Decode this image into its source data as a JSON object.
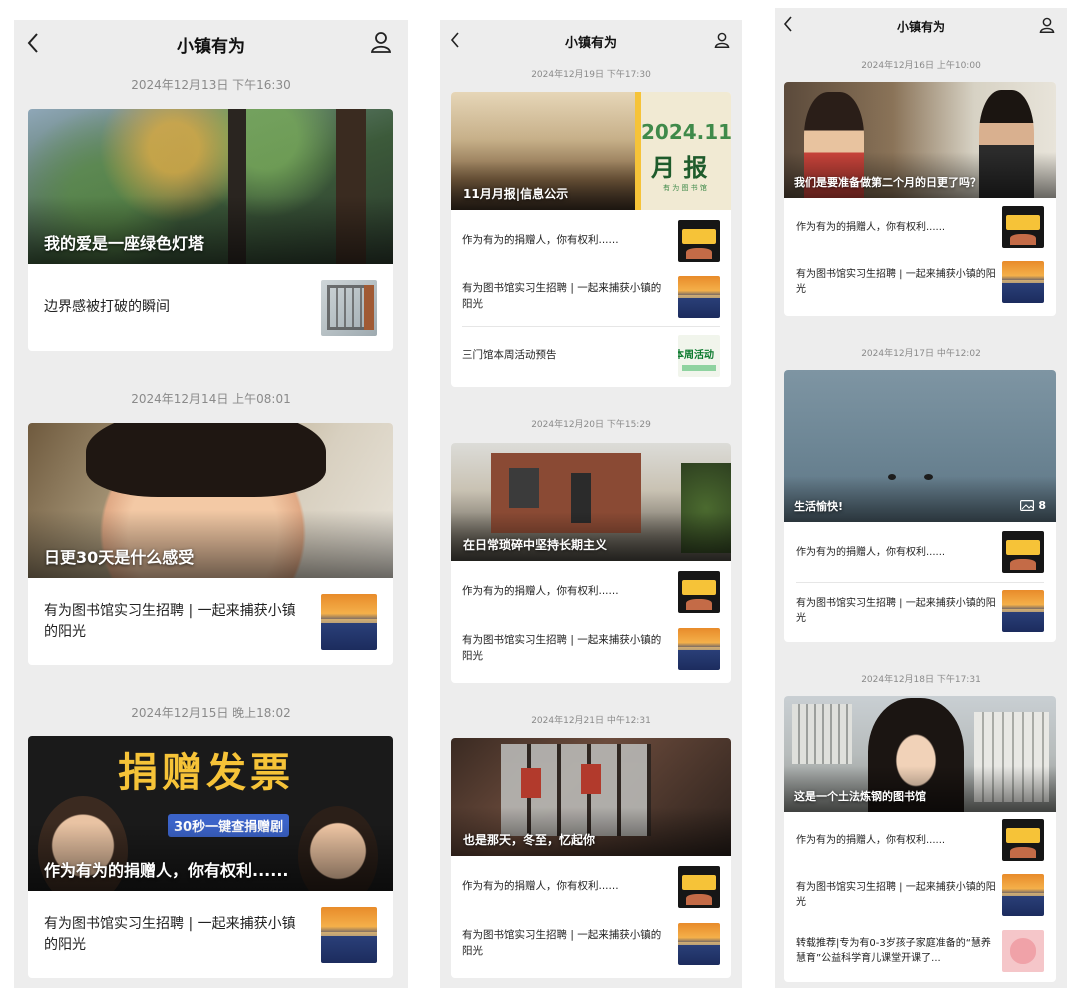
{
  "app_title": "小镇有为",
  "screens": [
    {
      "posts": [
        {
          "timestamp": "2024年12月13日 下午16:30",
          "hero_title": "我的爱是一座绿色灯塔",
          "items": [
            {
              "title": "边界感被打破的瞬间",
              "thumb": "window-thumbnail"
            }
          ]
        },
        {
          "timestamp": "2024年12月14日 上午08:01",
          "hero_title": "日更30天是什么感受",
          "items": [
            {
              "title": "有为图书馆实习生招聘 | 一起来捕获小镇的阳光",
              "thumb": "sunset-thumbnail"
            }
          ]
        },
        {
          "timestamp": "2024年12月15日 晚上18:02",
          "hero_title": "作为有为的捐赠人，你有权利......",
          "hero_overlay_big": "捐赠发票",
          "hero_overlay_small": "30秒一键查捐赠剧",
          "items": [
            {
              "title": "有为图书馆实习生招聘 | 一起来捕获小镇的阳光",
              "thumb": "sunset-thumbnail"
            }
          ]
        }
      ]
    },
    {
      "posts": [
        {
          "timestamp": "2024年12月19日 下午17:30",
          "hero_title": "11月月报|信息公示",
          "hero_overlay_year": "2024.11",
          "hero_overlay_big": "月 报",
          "hero_overlay_small": "有 为 图 书 馆",
          "items": [
            {
              "title": "作为有为的捐赠人，你有权利......",
              "thumb": "donate-thumbnail"
            },
            {
              "title": "有为图书馆实习生招聘 | 一起来捕获小镇的阳光",
              "thumb": "sunset-thumbnail"
            },
            {
              "title": "三门馆本周活动预告",
              "thumb": "weekly-thumbnail",
              "thumb_text": "本周活动"
            }
          ]
        },
        {
          "timestamp": "2024年12月20日 下午15:29",
          "hero_title": "在日常琐碎中坚持长期主义",
          "items": [
            {
              "title": "作为有为的捐赠人，你有权利......",
              "thumb": "donate-thumbnail"
            },
            {
              "title": "有为图书馆实习生招聘 | 一起来捕获小镇的阳光",
              "thumb": "sunset-thumbnail"
            }
          ]
        },
        {
          "timestamp": "2024年12月21日 中午12:31",
          "hero_title": "也是那天，冬至，忆起你",
          "items": [
            {
              "title": "作为有为的捐赠人，你有权利......",
              "thumb": "donate-thumbnail"
            },
            {
              "title": "有为图书馆实习生招聘 | 一起来捕获小镇的阳光",
              "thumb": "sunset-thumbnail"
            }
          ]
        }
      ]
    },
    {
      "posts": [
        {
          "timestamp": "2024年12月16日 上午10:00",
          "hero_title": "我们是要准备做第二个月的日更了吗？",
          "items": [
            {
              "title": "作为有为的捐赠人，你有权利......",
              "thumb": "donate-thumbnail"
            },
            {
              "title": "有为图书馆实习生招聘 | 一起来捕获小镇的阳光",
              "thumb": "sunset-thumbnail"
            }
          ]
        },
        {
          "timestamp": "2024年12月17日 中午12:02",
          "hero_title": "生活愉快!",
          "image_count": "8",
          "items": [
            {
              "title": "作为有为的捐赠人，你有权利......",
              "thumb": "donate-thumbnail"
            },
            {
              "title": "有为图书馆实习生招聘 | 一起来捕获小镇的阳光",
              "thumb": "sunset-thumbnail"
            }
          ]
        },
        {
          "timestamp": "2024年12月18日 下午17:31",
          "hero_title": "这是一个土法炼钢的图书馆",
          "items": [
            {
              "title": "作为有为的捐赠人，你有权利......",
              "thumb": "donate-thumbnail"
            },
            {
              "title": "有为图书馆实习生招聘 | 一起来捕获小镇的阳光",
              "thumb": "sunset-thumbnail"
            },
            {
              "title": "转载推荐|专为有0-3岁孩子家庭准备的“慧养慧育”公益科学育儿课堂开课了...",
              "thumb": "pink-thumbnail"
            }
          ]
        }
      ]
    }
  ]
}
